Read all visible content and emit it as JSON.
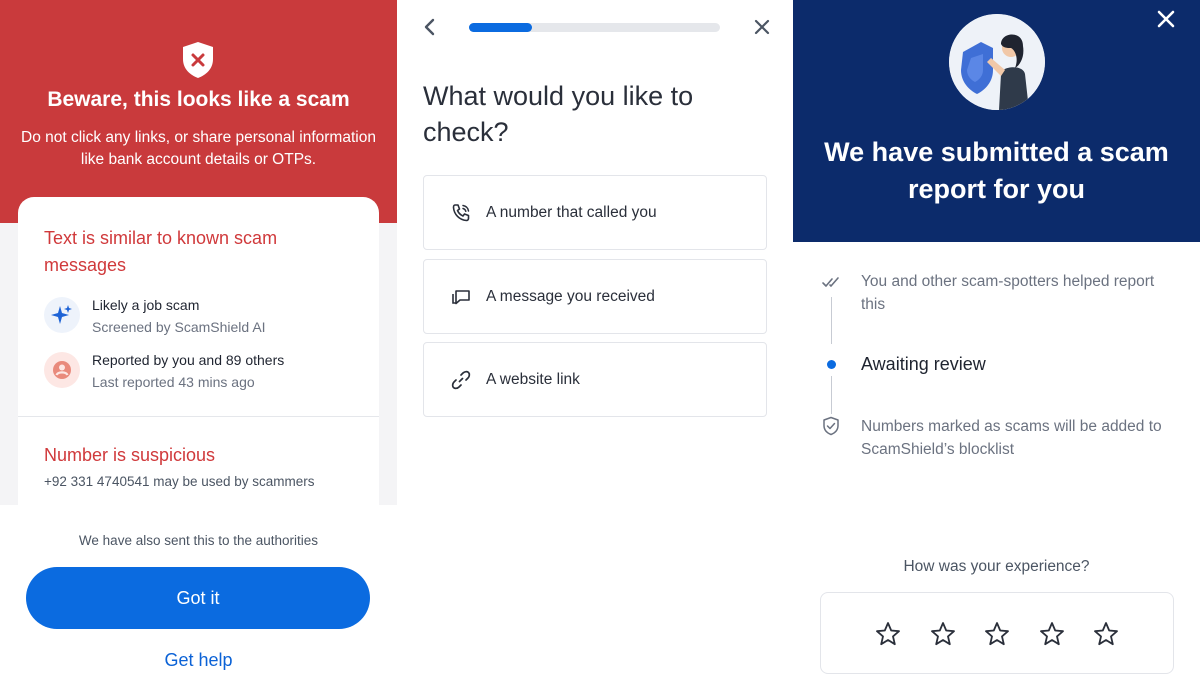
{
  "warning_screen": {
    "title": "Beware, this looks like a scam",
    "subtitle": "Do not click any links, or share personal information like bank account details or OTPs.",
    "card": {
      "title": "Text is similar to known scam messages",
      "rows": [
        {
          "icon": "sparkle-icon",
          "primary": "Likely a job scam",
          "secondary": "Screened by ScamShield AI"
        },
        {
          "icon": "user-icon",
          "primary": "Reported by you and 89 others",
          "secondary": "Last reported 43 mins ago"
        }
      ],
      "number_title": "Number is suspicious",
      "number_sub": "+92 331 4740541 may be used by scammers"
    },
    "authorities_note": "We have also sent this to the authorities",
    "primary_button": "Got it",
    "help_link": "Get help",
    "colors": {
      "header": "#c93a3c",
      "accent_text": "#d0393b",
      "button": "#0b6be0"
    }
  },
  "check_screen": {
    "progress": 0.25,
    "title": "What would you like to check?",
    "options": [
      {
        "icon": "phone-icon",
        "label": "A number that called you"
      },
      {
        "icon": "message-icon",
        "label": "A message you received"
      },
      {
        "icon": "link-icon",
        "label": "A website link"
      }
    ]
  },
  "report_screen": {
    "title": "We have submitted a scam report for you",
    "timeline": [
      {
        "icon": "double-check-icon",
        "text": "You and other scam-spotters helped report this"
      },
      {
        "icon": "dot-icon",
        "text": "Awaiting review"
      },
      {
        "icon": "shield-check-icon",
        "text": "Numbers marked as scams will be added to ScamShield’s blocklist"
      }
    ],
    "experience_question": "How was your experience?",
    "star_count": 5,
    "colors": {
      "header": "#0c2b6b",
      "active_dot": "#0b6be0"
    }
  }
}
